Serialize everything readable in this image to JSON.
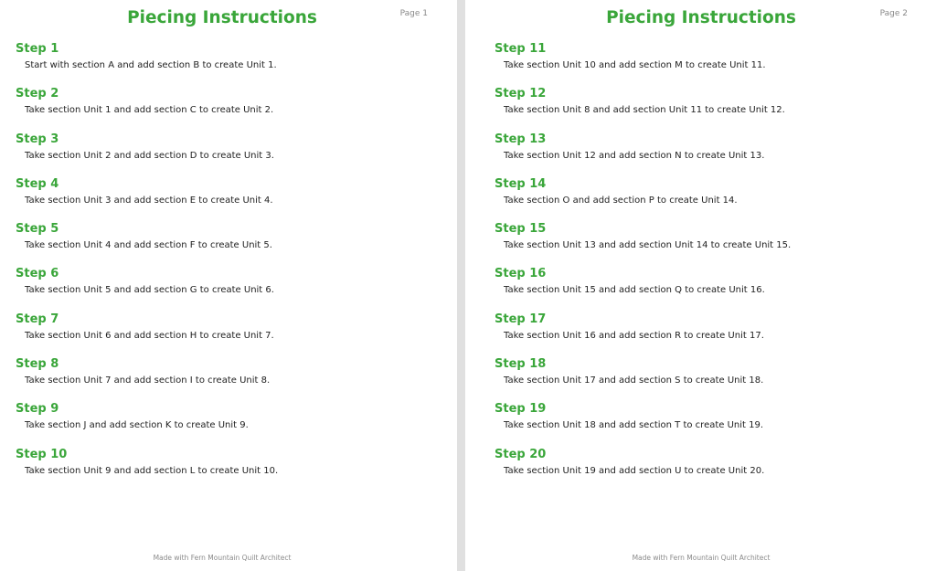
{
  "pages": [
    {
      "title": "Piecing Instructions",
      "page_label": "Page 1",
      "footer": "Made with Fern Mountain Quilt Architect",
      "steps": [
        {
          "heading": "Step 1",
          "text": "Start with section A and add section B to create Unit 1."
        },
        {
          "heading": "Step 2",
          "text": "Take section Unit 1 and add section C to create Unit 2."
        },
        {
          "heading": "Step 3",
          "text": "Take section Unit 2 and add section D to create Unit 3."
        },
        {
          "heading": "Step 4",
          "text": "Take section Unit 3 and add section E to create Unit 4."
        },
        {
          "heading": "Step 5",
          "text": "Take section Unit 4 and add section F to create Unit 5."
        },
        {
          "heading": "Step 6",
          "text": "Take section Unit 5 and add section G to create Unit 6."
        },
        {
          "heading": "Step 7",
          "text": "Take section Unit 6 and add section H to create Unit 7."
        },
        {
          "heading": "Step 8",
          "text": "Take section Unit 7 and add section I to create Unit 8."
        },
        {
          "heading": "Step 9",
          "text": "Take section J and add section K to create Unit 9."
        },
        {
          "heading": "Step 10",
          "text": "Take section Unit 9 and add section L to create Unit 10."
        }
      ]
    },
    {
      "title": "Piecing Instructions",
      "page_label": "Page 2",
      "footer": "Made with Fern Mountain Quilt Architect",
      "steps": [
        {
          "heading": "Step 11",
          "text": "Take section Unit 10 and add section M to create Unit 11."
        },
        {
          "heading": "Step 12",
          "text": "Take section Unit 8 and add section Unit 11 to create Unit 12."
        },
        {
          "heading": "Step 13",
          "text": "Take section Unit 12 and add section N to create Unit 13."
        },
        {
          "heading": "Step 14",
          "text": "Take section O and add section P to create Unit 14."
        },
        {
          "heading": "Step 15",
          "text": "Take section Unit 13 and add section Unit 14 to create Unit 15."
        },
        {
          "heading": "Step 16",
          "text": "Take section Unit 15 and add section Q to create Unit 16."
        },
        {
          "heading": "Step 17",
          "text": "Take section Unit 16 and add section R to create Unit 17."
        },
        {
          "heading": "Step 18",
          "text": "Take section Unit 17 and add section S to create Unit 18."
        },
        {
          "heading": "Step 19",
          "text": "Take section Unit 18 and add section T to create Unit 19."
        },
        {
          "heading": "Step 20",
          "text": "Take section Unit 19 and add section U to create Unit 20."
        }
      ]
    }
  ],
  "colors": {
    "heading": "#3aa63a",
    "body_text": "#222222",
    "muted": "#8a8a8a",
    "page": "#ffffff",
    "gutter": "#e0e0e0"
  }
}
